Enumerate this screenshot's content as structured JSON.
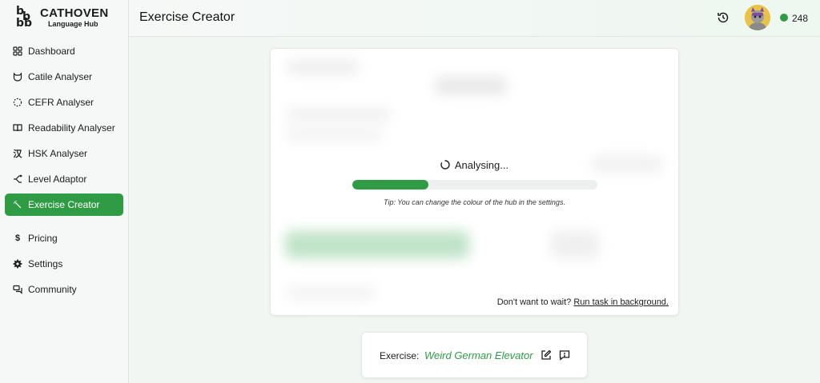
{
  "brand": {
    "name": "CATHOVEN",
    "subtitle": "Language Hub"
  },
  "sidebar": {
    "items": [
      {
        "label": "Dashboard",
        "icon": "grid-icon"
      },
      {
        "label": "Catile Analyser",
        "icon": "cat-icon"
      },
      {
        "label": "CEFR Analyser",
        "icon": "dashed-circle-icon"
      },
      {
        "label": "Readability Analyser",
        "icon": "book-icon"
      },
      {
        "label": "HSK Analyser",
        "icon": "hanzi-icon"
      },
      {
        "label": "Level Adaptor",
        "icon": "branch-icon"
      },
      {
        "label": "Exercise Creator",
        "icon": "wand-icon",
        "active": true
      }
    ],
    "footer_items": [
      {
        "label": "Pricing",
        "icon": "dollar-icon"
      },
      {
        "label": "Settings",
        "icon": "gear-icon"
      },
      {
        "label": "Community",
        "icon": "chat-icon"
      }
    ]
  },
  "header": {
    "title": "Exercise Creator",
    "credits": "248"
  },
  "analysis": {
    "status": "Analysing...",
    "progress": 0.31,
    "tip": "Tip: You can change the colour of the hub in the settings.",
    "wait_prefix": "Don't want to wait?",
    "wait_link": "Run task in background."
  },
  "exercise": {
    "label": "Exercise:",
    "title": "Weird German Elevator"
  },
  "colors": {
    "accent": "#2f9c45"
  }
}
